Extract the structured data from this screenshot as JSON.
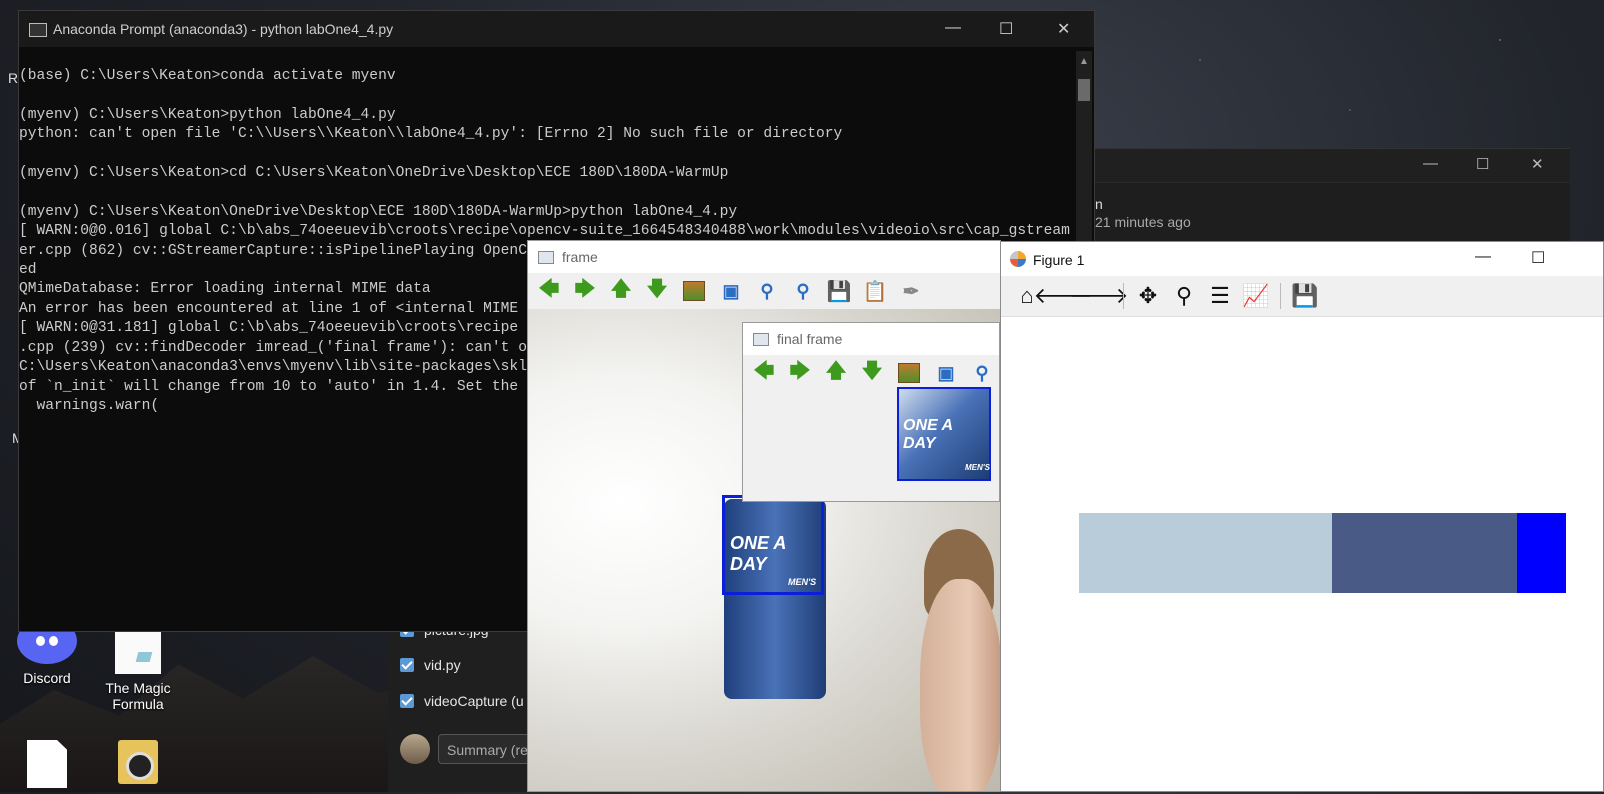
{
  "desktop": {
    "icons": [
      {
        "label": "Discord"
      },
      {
        "label": "The Magic Formula"
      },
      {
        "label": ""
      },
      {
        "label": ""
      }
    ],
    "edge_letters": [
      "R",
      "M"
    ]
  },
  "file_list": {
    "items": [
      {
        "label": "picture.jpg",
        "checked": true
      },
      {
        "label": "vid.py",
        "checked": true
      },
      {
        "label": "videoCapture (u",
        "checked": true
      }
    ],
    "summary_placeholder": "Summary (re"
  },
  "background_window": {
    "char": "n",
    "meta": "21 minutes ago"
  },
  "console": {
    "title": "Anaconda Prompt (anaconda3) - python  labOne4_4.py",
    "lines": [
      "(base) C:\\Users\\Keaton>conda activate myenv",
      "",
      "(myenv) C:\\Users\\Keaton>python labOne4_4.py",
      "python: can't open file 'C:\\\\Users\\\\Keaton\\\\labOne4_4.py': [Errno 2] No such file or directory",
      "",
      "(myenv) C:\\Users\\Keaton>cd C:\\Users\\Keaton\\OneDrive\\Desktop\\ECE 180D\\180DA-WarmUp",
      "",
      "(myenv) C:\\Users\\Keaton\\OneDrive\\Desktop\\ECE 180D\\180DA-WarmUp>python labOne4_4.py",
      "[ WARN:0@0.016] global C:\\b\\abs_74oeeuevib\\croots\\recipe\\opencv-suite_1664548340488\\work\\modules\\videoio\\src\\cap_gstream",
      "er.cpp (862) cv::GStreamerCapture::isPipelinePlaying OpenC",
      "ed",
      "QMimeDatabase: Error loading internal MIME data",
      "An error has been encountered at line 1 of <internal MIME",
      "[ WARN:0@31.181] global C:\\b\\abs_74oeeuevib\\croots\\recipe",
      ".cpp (239) cv::findDecoder imread_('final frame'): can't o",
      "C:\\Users\\Keaton\\anaconda3\\envs\\myenv\\lib\\site-packages\\skl",
      "of `n_init` will change from 10 to 'auto' in 1.4. Set the",
      "  warnings.warn("
    ]
  },
  "frame_window": {
    "title": "frame",
    "bottle_text": "ONE A DAY",
    "bottle_small": "MEN'S"
  },
  "final_frame_window": {
    "title": "final frame",
    "bottle_text": "ONE A DAY",
    "bottle_small": "MEN'S"
  },
  "figure_window": {
    "title": "Figure 1",
    "tools": [
      "home-icon",
      "back-icon",
      "forward-icon",
      "pan-icon",
      "zoom-icon",
      "configure-icon",
      "edit-axes-icon",
      "save-icon"
    ]
  },
  "chart_data": {
    "type": "bar",
    "orientation": "horizontal-stacked",
    "title": "",
    "xlabel": "",
    "ylabel": "",
    "segments": [
      {
        "fraction": 0.52,
        "color": "#b8ccd9"
      },
      {
        "fraction": 0.38,
        "color": "#4a5a86"
      },
      {
        "fraction": 0.1,
        "color": "#0000ff"
      }
    ]
  }
}
